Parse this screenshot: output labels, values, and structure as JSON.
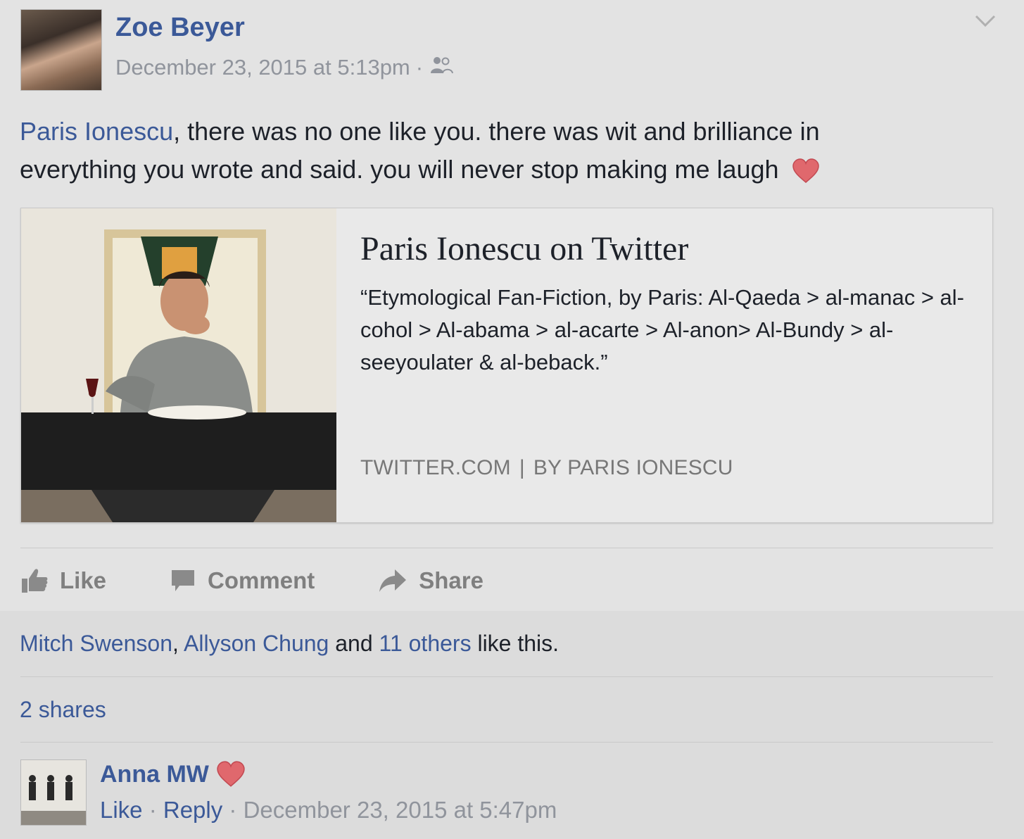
{
  "post": {
    "author": "Zoe Beyer",
    "timestamp": "December 23, 2015 at 5:13pm",
    "meta_sep": "·",
    "audience_icon": "friends-icon",
    "body_mention": "Paris Ionescu",
    "body_text": ", there was no one like you. there was wit and brilliance in everything you wrote and said. you will never stop making me laugh"
  },
  "link_card": {
    "title": "Paris Ionescu on Twitter",
    "description": "“Etymological Fan-Fiction, by Paris: Al-Qaeda > al-manac > al-cohol > Al-abama > al-acarte > Al-anon> Al-Bundy > al-seeyoulater & al-beback.”",
    "source": "TWITTER.COM",
    "source_sep": "|",
    "byline": "BY PARIS IONESCU"
  },
  "actions": {
    "like": "Like",
    "comment": "Comment",
    "share": "Share"
  },
  "likes": {
    "name1": "Mitch Swenson",
    "comma": ",",
    "name2": "Allyson Chung",
    "and": " and ",
    "others": "11 others",
    "suffix": " like this."
  },
  "shares": "2 shares",
  "comment": {
    "author": "Anna MW",
    "like": "Like",
    "dot": " · ",
    "reply": "Reply",
    "timestamp": "December 23, 2015 at 5:47pm"
  },
  "colors": {
    "link": "#3b5998",
    "heart": "#e0686d",
    "muted": "#90949c"
  }
}
